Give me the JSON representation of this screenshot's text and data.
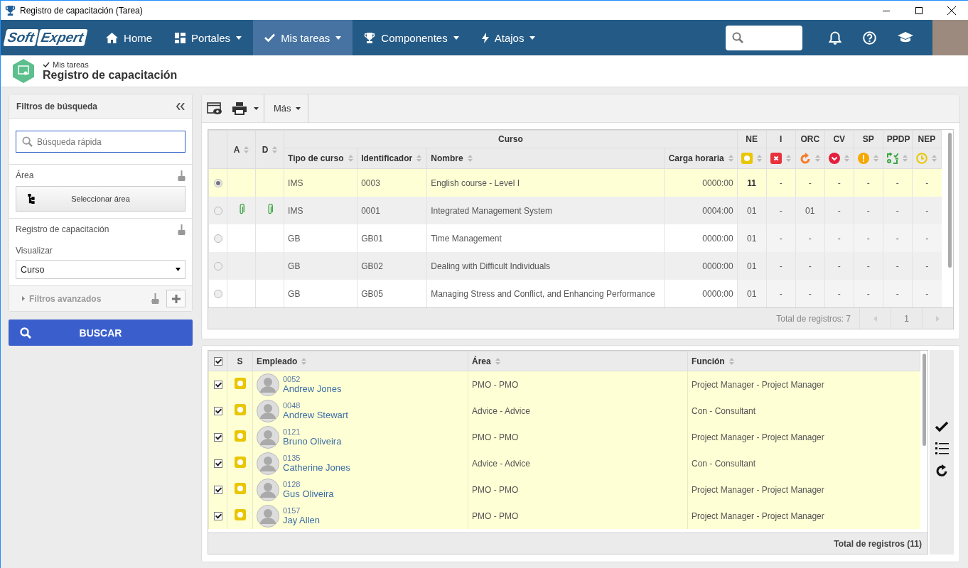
{
  "window": {
    "title": "Registro de capacitación (Tarea)"
  },
  "nav": {
    "logo": [
      "Soft",
      "Expert"
    ],
    "items": [
      {
        "label": "Home",
        "dropdown": false,
        "selected": false
      },
      {
        "label": "Portales",
        "dropdown": true,
        "selected": false
      },
      {
        "label": "Mis tareas",
        "dropdown": true,
        "selected": true
      },
      {
        "label": "Componentes",
        "dropdown": true,
        "selected": false
      },
      {
        "label": "Atajos",
        "dropdown": true,
        "selected": false
      }
    ]
  },
  "header": {
    "breadcrumb": "Mis tareas",
    "title": "Registro de capacitación"
  },
  "filters": {
    "title": "Filtros de búsqueda",
    "search_placeholder": "Búsqueda rápida",
    "area_label": "Área",
    "area_button": "Seleccionar área",
    "record_label": "Registro de capacitación",
    "view_label": "Visualizar",
    "view_value": "Curso",
    "advanced_label": "Filtros avanzados",
    "search_button": "BUSCAR"
  },
  "toolbar": {
    "more": "Más"
  },
  "courses": {
    "group": "Curso",
    "columns": [
      "A",
      "D",
      "Tipo de curso",
      "Identificador",
      "Nombre",
      "Carga horaria"
    ],
    "status_columns": [
      {
        "label": "NE",
        "kind": "ne"
      },
      {
        "label": "I",
        "kind": "i"
      },
      {
        "label": "ORC",
        "kind": "orc"
      },
      {
        "label": "CV",
        "kind": "cv"
      },
      {
        "label": "SP",
        "kind": "sp"
      },
      {
        "label": "PPDP",
        "kind": "ppdp"
      },
      {
        "label": "NEP",
        "kind": "nep"
      }
    ],
    "rows": [
      {
        "selected": true,
        "attachment_a": false,
        "attachment_d": false,
        "type": "IMS",
        "id": "0003",
        "name": "English course - Level I",
        "hours": "0000:00",
        "counts": [
          "11",
          "-",
          "-",
          "-",
          "-",
          "-",
          "-"
        ]
      },
      {
        "selected": false,
        "attachment_a": true,
        "attachment_d": true,
        "type": "IMS",
        "id": "0001",
        "name": "Integrated Management System",
        "hours": "0004:00",
        "counts": [
          "01",
          "-",
          "01",
          "-",
          "-",
          "-",
          "-"
        ]
      },
      {
        "selected": false,
        "attachment_a": false,
        "attachment_d": false,
        "type": "GB",
        "id": "GB01",
        "name": "Time Management",
        "hours": "0000:00",
        "counts": [
          "01",
          "-",
          "-",
          "-",
          "-",
          "-",
          "-"
        ]
      },
      {
        "selected": false,
        "attachment_a": false,
        "attachment_d": false,
        "type": "GB",
        "id": "GB02",
        "name": "Dealing with Difficult Individuals",
        "hours": "0000:00",
        "counts": [
          "01",
          "-",
          "-",
          "-",
          "-",
          "-",
          "-"
        ]
      },
      {
        "selected": false,
        "attachment_a": false,
        "attachment_d": false,
        "type": "GB",
        "id": "GB05",
        "name": "Managing Stress and Conflict, and Enhancing Performance",
        "hours": "0000:00",
        "counts": [
          "01",
          "-",
          "-",
          "-",
          "-",
          "-",
          "-"
        ]
      }
    ],
    "total": "Total de registros: 7",
    "page": "1"
  },
  "employees": {
    "all_checked": true,
    "columns": [
      "S",
      "Empleado",
      "Área",
      "Función"
    ],
    "rows": [
      {
        "checked": true,
        "code": "0052",
        "name": "Andrew Jones",
        "area": "PMO - PMO",
        "role": "Project Manager - Project Manager"
      },
      {
        "checked": true,
        "code": "0048",
        "name": "Andrew Stewart",
        "area": "Advice - Advice",
        "role": "Con - Consultant"
      },
      {
        "checked": true,
        "code": "0121",
        "name": "Bruno Oliveira",
        "area": "PMO - PMO",
        "role": "Project Manager - Project Manager"
      },
      {
        "checked": true,
        "code": "0135",
        "name": "Catherine Jones",
        "area": "Advice - Advice",
        "role": "Con - Consultant"
      },
      {
        "checked": true,
        "code": "0128",
        "name": "Gus Oliveira",
        "area": "PMO - PMO",
        "role": "Project Manager - Project Manager"
      },
      {
        "checked": true,
        "code": "0157",
        "name": "Jay Allen",
        "area": "PMO - PMO",
        "role": "Project Manager - Project Manager"
      }
    ],
    "total": "Total de registros (11)"
  }
}
